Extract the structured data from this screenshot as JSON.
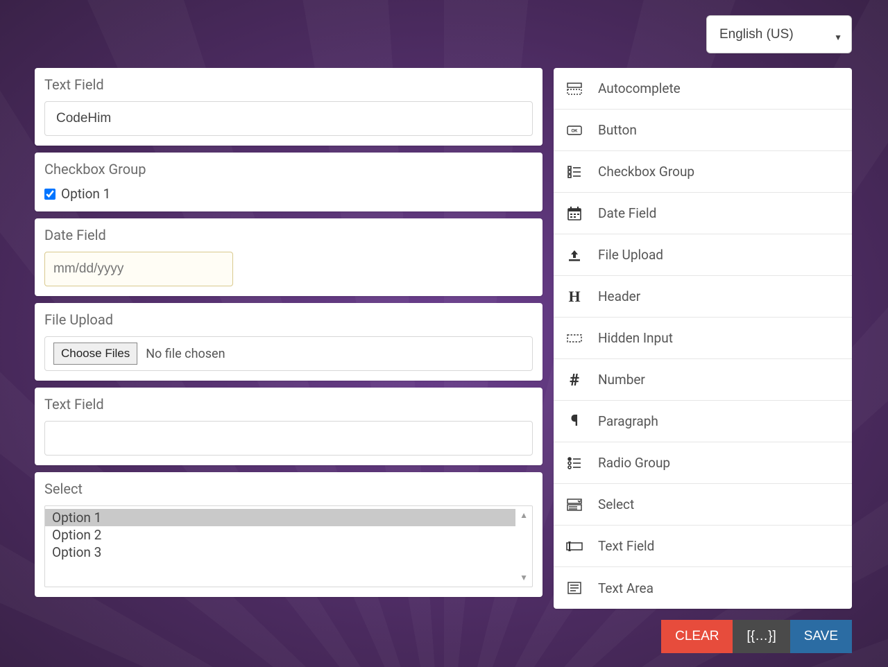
{
  "language": {
    "selected": "English (US)"
  },
  "canvas": {
    "fields": [
      {
        "label": "Text Field",
        "value": "CodeHim"
      },
      {
        "label": "Checkbox Group",
        "option_label": "Option 1",
        "checked": true
      },
      {
        "label": "Date Field",
        "placeholder": "mm/dd/yyyy"
      },
      {
        "label": "File Upload",
        "button": "Choose Files",
        "status": "No file chosen"
      },
      {
        "label": "Text Field",
        "value": ""
      },
      {
        "label": "Select",
        "options": [
          "Option 1",
          "Option 2",
          "Option 3"
        ],
        "selected_index": 0
      }
    ]
  },
  "palette": {
    "items": [
      {
        "label": "Autocomplete",
        "icon": "autocomplete"
      },
      {
        "label": "Button",
        "icon": "button"
      },
      {
        "label": "Checkbox Group",
        "icon": "checkbox-group"
      },
      {
        "label": "Date Field",
        "icon": "date"
      },
      {
        "label": "File Upload",
        "icon": "upload"
      },
      {
        "label": "Header",
        "icon": "header"
      },
      {
        "label": "Hidden Input",
        "icon": "hidden"
      },
      {
        "label": "Number",
        "icon": "hash"
      },
      {
        "label": "Paragraph",
        "icon": "pilcrow"
      },
      {
        "label": "Radio Group",
        "icon": "radio-group"
      },
      {
        "label": "Select",
        "icon": "select"
      },
      {
        "label": "Text Field",
        "icon": "textfield"
      },
      {
        "label": "Text Area",
        "icon": "textarea"
      }
    ]
  },
  "actions": {
    "clear": "CLEAR",
    "json": "[{…}]",
    "save": "SAVE"
  }
}
